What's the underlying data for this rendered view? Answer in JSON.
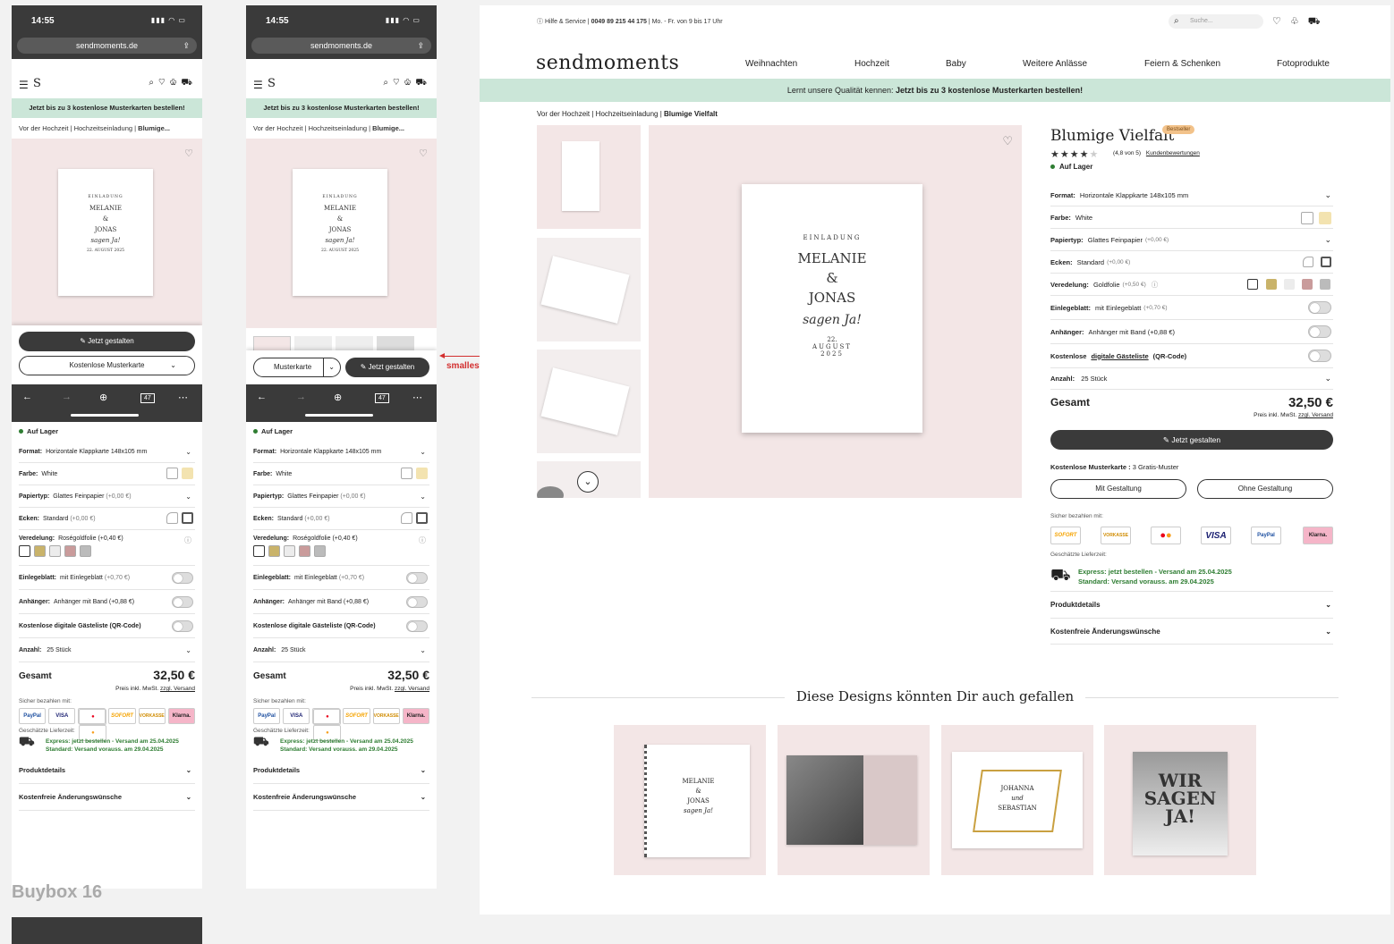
{
  "mobile": {
    "time": "14:55",
    "url": "sendmoments.de",
    "banner": "Jetzt bis zu 3 kostenlose Musterkarten bestellen!",
    "breadcrumb": [
      "Vor der Hochzeit",
      "Hochzeitseinladung",
      "Blumige..."
    ],
    "card": {
      "line1": "EINLADUNG",
      "name1": "MELANIE",
      "amp": "&",
      "name2": "JONAS",
      "script": "sagen Ja!",
      "date": "22. AUGUST 2025"
    },
    "cta_primary": "Jetzt gestalten",
    "cta_sample": "Kostenlose Musterkarte",
    "cta_sample_short": "Musterkarte",
    "tabs_count": "47",
    "stock": "Auf Lager",
    "rows": {
      "format_label": "Format:",
      "format_value": "Horizontale Klappkarte 148x105 mm",
      "farbe_label": "Farbe:",
      "farbe_value": "White",
      "papier_label": "Papiertyp:",
      "papier_value": "Glattes Feinpapier",
      "papier_extra": "(+0,00 €)",
      "ecken_label": "Ecken:",
      "ecken_value": "Standard",
      "ecken_extra": "(+0,00 €)",
      "veredelung_label": "Veredelung:",
      "veredelung_value": "Roségoldfolie (+0,40 €)",
      "einlege_label": "Einlegeblatt:",
      "einlege_value": "mit Einlegeblatt",
      "einlege_extra": "(+0,70 €)",
      "anhaenger_label": "Anhänger:",
      "anhaenger_value": "Anhänger mit Band (+0,88 €)",
      "gaeste_label": "Kostenlose digitale Gästeliste (QR-Code)",
      "anzahl_label": "Anzahl:",
      "anzahl_value": "25 Stück"
    },
    "total_label": "Gesamt",
    "total_price": "32,50 €",
    "price_note": "Preis inkl. MwSt.",
    "price_note_link": "zzgl. Versand",
    "pay_label": "Sicher bezahlen mit:",
    "pay_methods": [
      "PayPal",
      "VISA",
      "Mastercard",
      "SOFORT",
      "VORKASSE",
      "Klarna."
    ],
    "delivery_label": "Geschätzte Lieferzeit:",
    "delivery_express": "Express: jetzt bestellen - Versand am 25.04.2025",
    "delivery_standard": "Standard: Versand vorauss. am 29.04.2025",
    "acc_product": "Produktdetails",
    "acc_changes": "Kostenfreie Änderungswünsche"
  },
  "annotation": "smallest mobile size",
  "frame_label": "Buybox 16",
  "desktop": {
    "service": "Hilfe & Service",
    "phone": "0049 89 215 44 175",
    "hours": "Mo. - Fr. von 9 bis 17 Uhr",
    "search_placeholder": "Suche...",
    "logo": "sendmoments",
    "nav": [
      "Weihnachten",
      "Hochzeit",
      "Baby",
      "Weitere Anlässe",
      "Feiern & Schenken",
      "Fotoprodukte"
    ],
    "banner_pre": "Lernt unsere Qualität kennen:",
    "banner_bold": "Jetzt bis zu 3 kostenlose Musterkarten bestellen!",
    "breadcrumb": [
      "Vor der Hochzeit",
      "Hochzeitseinladung",
      "Blumige Vielfalt"
    ],
    "title": "Blumige Vielfalt",
    "badge": "Bestseller",
    "rating": "(4,8 von 5)",
    "rating_link": "Kundenbewertungen",
    "rating_value": 4.8,
    "stock": "Auf Lager",
    "rows": {
      "format_label": "Format:",
      "format_value": "Horizontale Klappkarte 148x105 mm",
      "farbe_label": "Farbe:",
      "farbe_value": "White",
      "papier_label": "Papiertyp:",
      "papier_value": "Glattes Feinpapier",
      "papier_extra": "(+0,00 €)",
      "ecken_label": "Ecken:",
      "ecken_value": "Standard",
      "ecken_extra": "(+0,00 €)",
      "veredelung_label": "Veredelung:",
      "veredelung_value": "Goldfolie",
      "veredelung_extra": "(+0,50 €)",
      "einlege_label": "Einlegeblatt:",
      "einlege_value": "mit Einlegeblatt",
      "einlege_extra": "(+0,70 €)",
      "anhaenger_label": "Anhänger:",
      "anhaenger_value": "Anhänger mit Band (+0,88 €)",
      "gaeste_label_pre": "Kostenlose",
      "gaeste_label_link": "digitale Gästeliste",
      "gaeste_label_post": "(QR-Code)",
      "anzahl_label": "Anzahl:",
      "anzahl_value": "25 Stück"
    },
    "total_label": "Gesamt",
    "total_price": "32,50 €",
    "price_note": "Preis inkl. MwSt.",
    "price_note_link": "zzgl. Versand",
    "cta_primary": "Jetzt gestalten",
    "muster_label": "Kostenlose Musterkarte :",
    "muster_value": "3 Gratis-Muster",
    "btn_with": "Mit Gestaltung",
    "btn_without": "Ohne Gestaltung",
    "pay_label": "Sicher bezahlen mit:",
    "pay_methods": [
      "SOFORT",
      "VORKASSE",
      "Mastercard",
      "VISA",
      "PayPal",
      "Klarna."
    ],
    "delivery_label": "Geschätzte Lieferzeit:",
    "delivery_express": "Express: jetzt bestellen - Versand am 25.04.2025",
    "delivery_standard": "Standard: Versand vorauss. am 29.04.2025",
    "acc_product": "Produktdetails",
    "acc_changes": "Kostenfreie Änderungswünsche",
    "recommend_title": "Diese Designs könnten Dir auch gefallen",
    "card": {
      "line1": "EINLADUNG",
      "name1": "MELANIE",
      "amp": "&",
      "name2": "JONAS",
      "script": "sagen Ja!",
      "date1": "22.",
      "date2": "AUGUST",
      "date3": "2025"
    },
    "rec2": {
      "name1": "JOHANNA",
      "amp": "und",
      "name2": "SEBASTIAN"
    },
    "rec3": "WIR SAGEN JA!"
  },
  "colors": {
    "banner": "#cbe6d8",
    "image_bg": "#f3e6e6",
    "dark": "#3a3a3a",
    "green": "#2e7d32",
    "annotation": "#d32f2f"
  }
}
